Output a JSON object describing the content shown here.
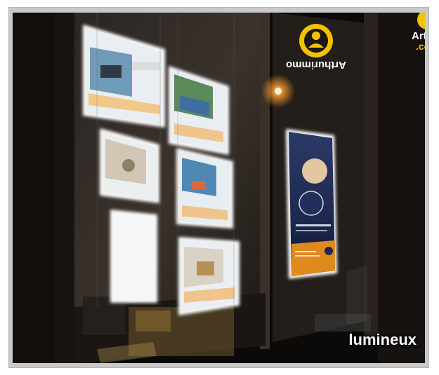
{
  "photo": {
    "caption": "lumineux",
    "logo_brand": "Arthurimmo",
    "logo_tld": ".com",
    "colors": {
      "led_glow": "#ffffff",
      "brand_yellow": "#f2c200",
      "poster_blue": "#1d2d55",
      "poster_orange": "#e08a1e",
      "street_light": "#ffb347"
    }
  }
}
